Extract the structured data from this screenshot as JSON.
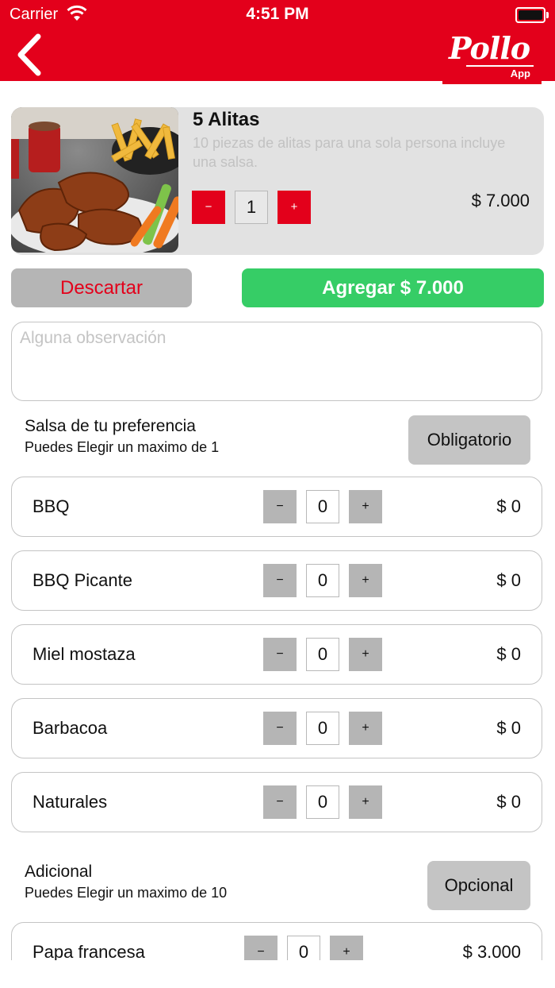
{
  "status_bar": {
    "carrier": "Carrier",
    "time": "4:51 PM"
  },
  "header": {
    "logo_text": "Pollo",
    "logo_sub": "App"
  },
  "product": {
    "name": "5 Alitas",
    "description": "10 piezas de alitas para una sola persona incluye una salsa.",
    "quantity": "1",
    "minus_label": "−",
    "plus_label": "+",
    "price": "$ 7.000"
  },
  "actions": {
    "discard_label": "Descartar",
    "add_label": "Agregar $ 7.000"
  },
  "observation": {
    "placeholder": "Alguna observación",
    "value": ""
  },
  "groups": [
    {
      "title": "Salsa de tu preferencia",
      "subtitle": "Puedes Elegir un maximo de 1",
      "tag": "Obligatorio",
      "options": [
        {
          "name": "BBQ",
          "qty": "0",
          "price": "$ 0"
        },
        {
          "name": "BBQ Picante",
          "qty": "0",
          "price": "$ 0"
        },
        {
          "name": "Miel mostaza",
          "qty": "0",
          "price": "$ 0"
        },
        {
          "name": "Barbacoa",
          "qty": "0",
          "price": "$ 0"
        },
        {
          "name": "Naturales",
          "qty": "0",
          "price": "$ 0"
        }
      ]
    },
    {
      "title": "Adicional",
      "subtitle": "Puedes Elegir un maximo de 10",
      "tag": "Opcional",
      "options": [
        {
          "name": "Papa francesa",
          "qty": "0",
          "price": "$ 3.000"
        }
      ]
    }
  ],
  "stepper": {
    "minus": "−",
    "plus": "+"
  },
  "colors": {
    "brand_red": "#e3001b",
    "add_green": "#36cd66",
    "neutral_gray": "#b5b5b5"
  }
}
